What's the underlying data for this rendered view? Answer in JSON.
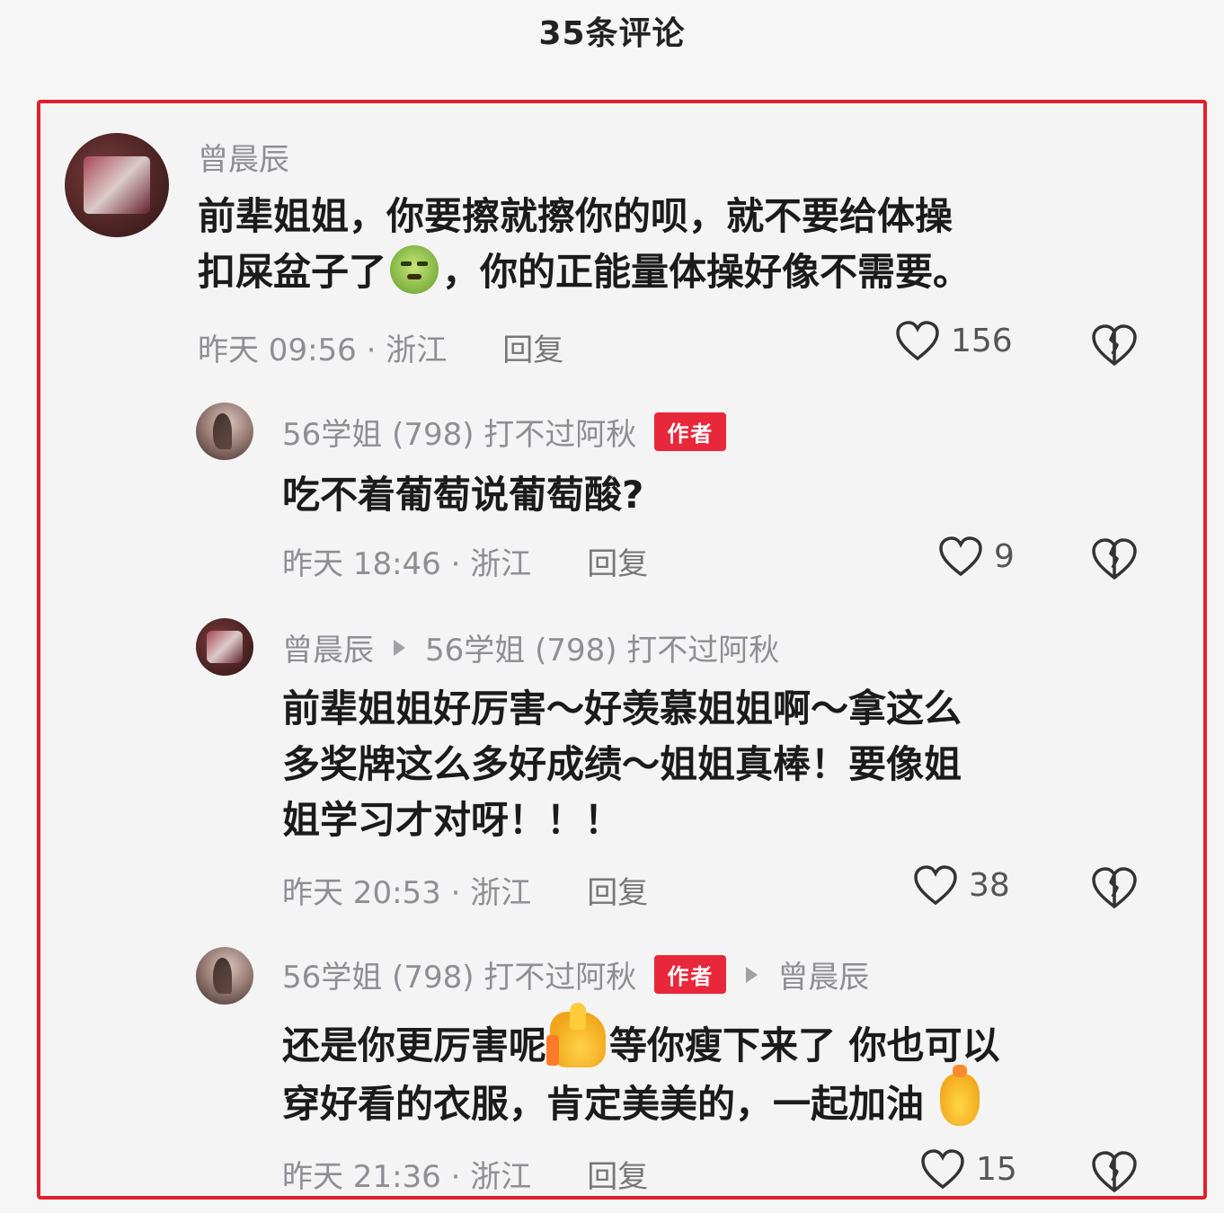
{
  "header": {
    "title": "35条评论"
  },
  "comments": [
    {
      "author": "曾晨辰",
      "text_line1": "前辈姐姐，你要擦就擦你的呗，就不要给体操",
      "text_line2a": "扣屎盆子了",
      "text_line2b": "，你的正能量体操好像不需要。",
      "time": "昨天 09:56 · 浙江",
      "reply": "回复",
      "likes": "156"
    },
    {
      "author": "56学姐 (798) 打不过阿秋",
      "badge": "作者",
      "text": "吃不着葡萄说葡萄酸?",
      "time": "昨天 18:46 · 浙江",
      "reply": "回复",
      "likes": "9"
    },
    {
      "author": "曾晨辰",
      "reply_to": "56学姐 (798) 打不过阿秋",
      "text_line1": "前辈姐姐好厉害～好羡慕姐姐啊～拿这么",
      "text_line2": "多奖牌这么多好成绩～姐姐真棒！要像姐",
      "text_line3": "姐学习才对呀！！！",
      "time": "昨天 20:53 · 浙江",
      "reply": "回复",
      "likes": "38"
    },
    {
      "author": "56学姐 (798) 打不过阿秋",
      "badge": "作者",
      "reply_to": "曾晨辰",
      "text_line1a": "还是你更厉害呢",
      "text_line1b": "等你瘦下来了 你也可以",
      "text_line2": "穿好看的衣服，肯定美美的，一起加油",
      "time": "昨天 21:36 · 浙江",
      "reply": "回复",
      "likes": "15"
    }
  ],
  "icons": {
    "like": "heart-icon",
    "dislike": "broken-heart-icon",
    "emoji1": "crying-face-emoji-icon",
    "emoji2": "thumbs-up-emoji-icon",
    "emoji3": "fist-emoji-icon"
  },
  "colors": {
    "frame": "#e0202a",
    "badge": "#e8283a"
  }
}
